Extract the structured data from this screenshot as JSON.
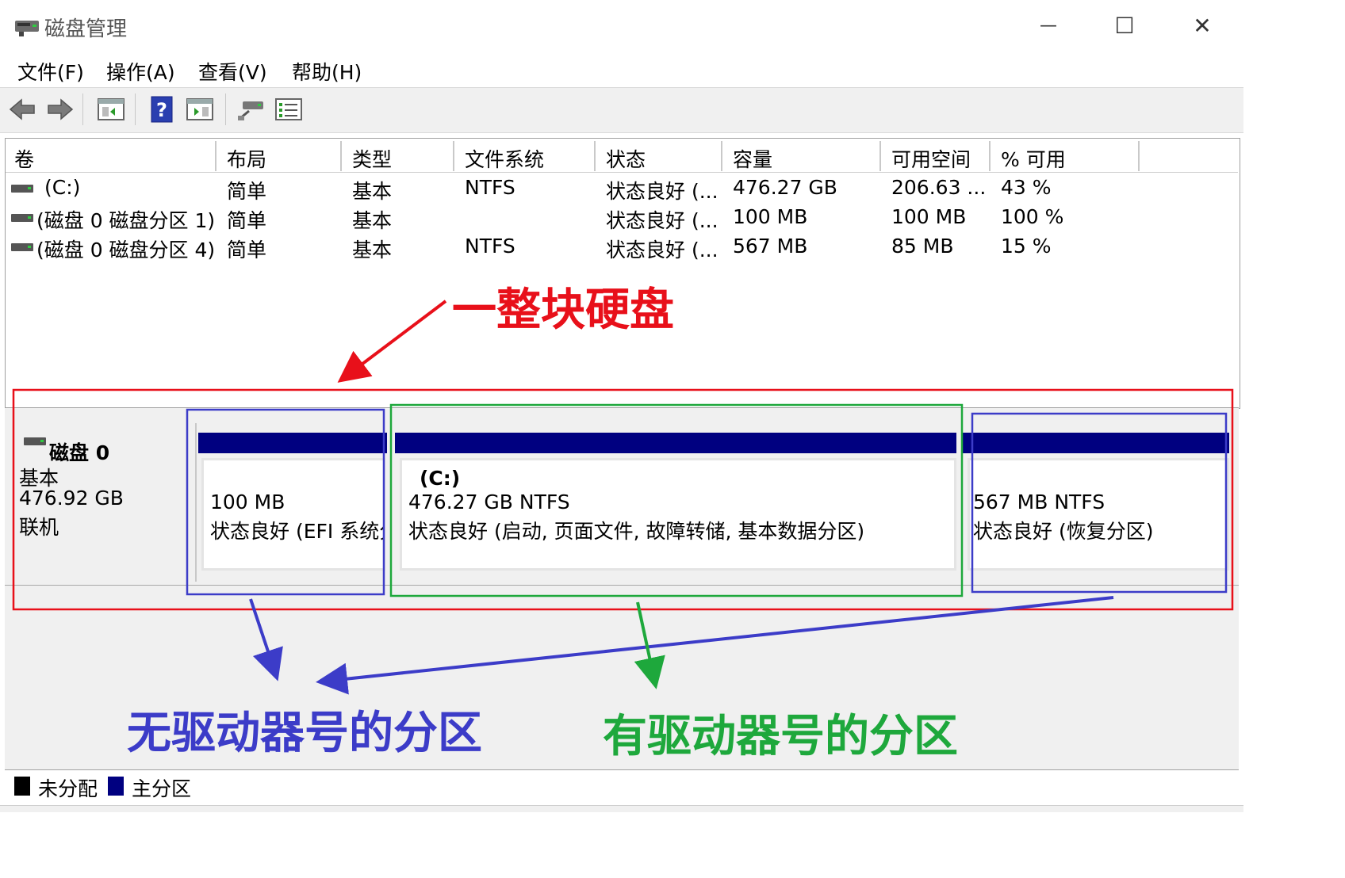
{
  "window": {
    "title": "磁盘管理",
    "minimize_symbol": "—",
    "maximize_symbol": "☐",
    "close_symbol": "✕"
  },
  "menu": [
    "文件(F)",
    "操作(A)",
    "查看(V)",
    "帮助(H)"
  ],
  "toolbar_icons": [
    "back-icon",
    "forward-icon",
    "console-tree-icon",
    "help-icon",
    "action-pane-icon",
    "connect-drive-icon",
    "properties-icon"
  ],
  "volume_list": {
    "columns": [
      "卷",
      "布局",
      "类型",
      "文件系统",
      "状态",
      "容量",
      "可用空间",
      "% 可用"
    ],
    "rows": [
      {
        "volume": "(C:)",
        "layout": "简单",
        "type": "基本",
        "fs": "NTFS",
        "status": "状态良好 (...",
        "capacity": "476.27 GB",
        "free": "206.63 ...",
        "pct": "43 %"
      },
      {
        "volume": "(磁盘 0 磁盘分区 1)",
        "layout": "简单",
        "type": "基本",
        "fs": "",
        "status": "状态良好 (...",
        "capacity": "100 MB",
        "free": "100 MB",
        "pct": "100 %"
      },
      {
        "volume": "(磁盘 0 磁盘分区 4)",
        "layout": "简单",
        "type": "基本",
        "fs": "NTFS",
        "status": "状态良好 (...",
        "capacity": "567 MB",
        "free": "85 MB",
        "pct": "15 %"
      }
    ]
  },
  "disk": {
    "name": "磁盘 0",
    "type": "基本",
    "size": "476.92 GB",
    "state": "联机",
    "partitions": [
      {
        "title": "",
        "size": "100 MB",
        "status": "状态良好 (EFI 系统分"
      },
      {
        "title": "(C:)",
        "size": "476.27 GB NTFS",
        "status": "状态良好 (启动, 页面文件, 故障转储, 基本数据分区)"
      },
      {
        "title": "",
        "size": "567 MB NTFS",
        "status": "状态良好 (恢复分区)"
      }
    ]
  },
  "legend": [
    {
      "label": "未分配",
      "color": "#000000"
    },
    {
      "label": "主分区",
      "color": "#000080"
    }
  ],
  "annotations": {
    "whole_disk": "一整块硬盘",
    "no_letter": "无驱动器号的分区",
    "with_letter": "有驱动器号的分区",
    "colors": {
      "red": "#e8101a",
      "blue": "#3c3cc8",
      "green": "#1ea83c"
    }
  }
}
